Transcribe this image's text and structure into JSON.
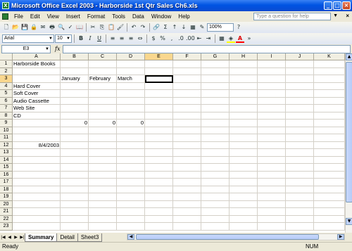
{
  "window": {
    "title": "Microsoft Office Excel 2003 - Harborside 1st Qtr Sales Ch6.xls",
    "app_icon": "X"
  },
  "menu": {
    "items": [
      "File",
      "Edit",
      "View",
      "Insert",
      "Format",
      "Tools",
      "Data",
      "Window",
      "Help"
    ],
    "help_placeholder": "Type a question for help"
  },
  "toolbar": {
    "zoom": "100%",
    "font_name": "Arial",
    "font_size": "10",
    "bold_label": "B",
    "italic_label": "I",
    "underline_label": "U",
    "currency_label": "$",
    "percent_label": "%",
    "autosum_label": "Σ",
    "fill_color": "#ffff00",
    "font_color": "#ff0000"
  },
  "formula_bar": {
    "name_box": "E3",
    "fx_label": "fx",
    "value": ""
  },
  "grid": {
    "columns": [
      "A",
      "B",
      "C",
      "D",
      "E",
      "F",
      "G",
      "H",
      "I",
      "J",
      "K"
    ],
    "selected_column": "E",
    "selected_row": "3",
    "active_cell": "E3",
    "rows": [
      {
        "n": "1",
        "cells": {
          "A": "Harborside Books"
        }
      },
      {
        "n": "2",
        "cells": {}
      },
      {
        "n": "3",
        "cells": {
          "B": "January",
          "C": "February",
          "D": "March"
        }
      },
      {
        "n": "4",
        "cells": {
          "A": "Hard Cover"
        }
      },
      {
        "n": "5",
        "cells": {
          "A": "Soft Cover"
        }
      },
      {
        "n": "6",
        "cells": {
          "A": "Audio Cassette"
        }
      },
      {
        "n": "7",
        "cells": {
          "A": "Web Site"
        }
      },
      {
        "n": "8",
        "cells": {
          "A": "CD"
        }
      },
      {
        "n": "9",
        "cells": {
          "B": "0",
          "C": "0",
          "D": "0"
        }
      },
      {
        "n": "10",
        "cells": {}
      },
      {
        "n": "11",
        "cells": {}
      },
      {
        "n": "12",
        "cells": {
          "A": "8/4/2003"
        }
      },
      {
        "n": "13",
        "cells": {}
      },
      {
        "n": "14",
        "cells": {}
      },
      {
        "n": "15",
        "cells": {}
      },
      {
        "n": "16",
        "cells": {}
      },
      {
        "n": "17",
        "cells": {}
      },
      {
        "n": "18",
        "cells": {}
      },
      {
        "n": "19",
        "cells": {}
      },
      {
        "n": "20",
        "cells": {}
      },
      {
        "n": "21",
        "cells": {}
      },
      {
        "n": "22",
        "cells": {}
      },
      {
        "n": "23",
        "cells": {}
      }
    ],
    "numeric_cells": [
      "B9",
      "C9",
      "D9",
      "A12"
    ]
  },
  "sheets": {
    "tabs": [
      "Summary",
      "Detail",
      "Sheet3"
    ],
    "active": "Summary"
  },
  "status": {
    "left": "Ready",
    "num": "NUM"
  },
  "colors": {
    "title_bar": "#0054e3",
    "selected_header": "#f9d78e"
  }
}
